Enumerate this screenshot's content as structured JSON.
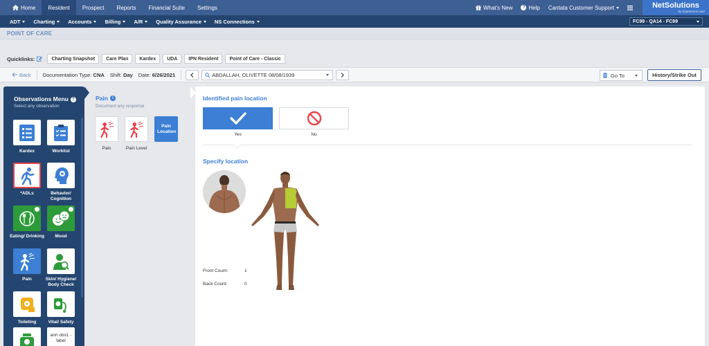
{
  "topnav": {
    "tabs": [
      {
        "label": "Home",
        "icon": "home-icon"
      },
      {
        "label": "Resident",
        "active": true
      },
      {
        "label": "Prospect"
      },
      {
        "label": "Reports"
      },
      {
        "label": "Financial Suite"
      },
      {
        "label": "Settings"
      }
    ],
    "whats_new": "What's New",
    "help": "Help",
    "support": "Cantata Customer Support",
    "logo_main": "NetSolutions",
    "logo_sub": "by Experience care"
  },
  "subnav": {
    "items": [
      "ADT",
      "Charting",
      "Accounts",
      "Billing",
      "A/R",
      "Quality Assurance",
      "NS Connections"
    ],
    "facility": "FC99 - QA14 - FC99"
  },
  "page_title": "POINT OF CARE",
  "quicklinks": {
    "label": "Quicklinks:",
    "links": [
      "Charting Snapshot",
      "Care Plan",
      "Kardex",
      "UDA",
      "IPN Resident",
      "Point of Care - Classic"
    ]
  },
  "toolbar": {
    "back": "Back",
    "doc_type_label": "Documentation Type:",
    "doc_type_value": "CNA",
    "shift_label": "Shift:",
    "shift_value": "Day",
    "date_label": "Date:",
    "date_value": "6/26/2021",
    "patient": "ABDALLAH, OLIVETTE 08/08/1939",
    "goto": "Go To",
    "history": "History/Strike Out"
  },
  "obs_menu": {
    "title": "Observations Menu",
    "subtitle": "Select any observation",
    "tiles": [
      {
        "label": "Kardex",
        "icon": "kardex-icon"
      },
      {
        "label": "Worklist",
        "icon": "worklist-icon"
      },
      {
        "label": "*ADLs",
        "icon": "walking-person-icon",
        "selected": true
      },
      {
        "label": "Behavior/ Cognition",
        "icon": "brain-head-icon"
      },
      {
        "label": "Eating/ Drinking",
        "icon": "utensils-icon",
        "checked": true
      },
      {
        "label": "Mood",
        "icon": "mood-faces-icon",
        "checked": true
      },
      {
        "label": "Pain",
        "icon": "pain-icon"
      },
      {
        "label": "Skin/ Hygiene/ Body Check",
        "icon": "skin-check-icon"
      },
      {
        "label": "Toileting",
        "icon": "toilet-paper-icon"
      },
      {
        "label": "Vital/ Safety",
        "icon": "vitals-icon"
      },
      {
        "label": "",
        "icon": "scale-icon"
      },
      {
        "label": "ann obs1 - label",
        "icon": ""
      }
    ]
  },
  "pain": {
    "title": "Pain",
    "subtitle": "Document any response",
    "options": [
      {
        "label": "Pain"
      },
      {
        "label": "Pain Level"
      },
      {
        "label": "Pain Location",
        "selected": true
      }
    ]
  },
  "main": {
    "identified_title": "Identified pain location",
    "yes_label": "Yes",
    "no_label": "No",
    "specify_title": "Specify location",
    "front_count_label": "Front Count:",
    "front_count_value": "1",
    "back_count_label": "Back Count:",
    "back_count_value": "0"
  },
  "colors": {
    "nav": "#3d5f93",
    "subnav": "#24456f",
    "accent": "#3c7fd4",
    "success": "#2e9b3a",
    "selected_border": "#e8434b",
    "highlight_area": "#b8d432",
    "no_icon": "#e8434b"
  }
}
